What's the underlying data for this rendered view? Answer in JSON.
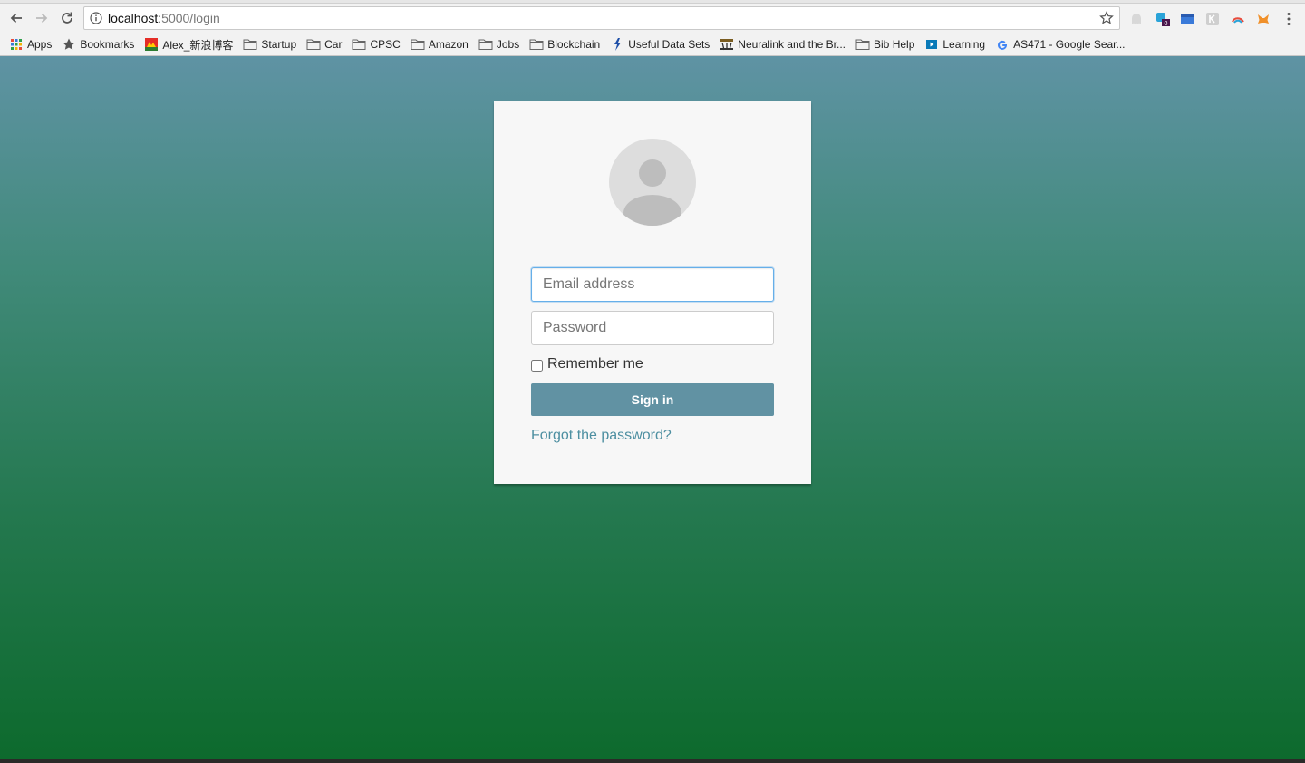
{
  "browser": {
    "url_host": "localhost",
    "url_path": ":5000/login",
    "bookmarks": [
      {
        "label": "Apps",
        "icon": "apps-grid-icon"
      },
      {
        "label": "Bookmarks",
        "icon": "star-icon"
      },
      {
        "label": "Alex_新浪博客",
        "icon": "weibo-icon"
      },
      {
        "label": "Startup",
        "icon": "folder-icon"
      },
      {
        "label": "Car",
        "icon": "folder-icon"
      },
      {
        "label": "CPSC",
        "icon": "folder-icon"
      },
      {
        "label": "Amazon",
        "icon": "folder-icon"
      },
      {
        "label": "Jobs",
        "icon": "folder-icon"
      },
      {
        "label": "Blockchain",
        "icon": "folder-icon"
      },
      {
        "label": "Useful Data Sets",
        "icon": "data-site-icon"
      },
      {
        "label": "Neuralink and the Br...",
        "icon": "waitbutwhy-icon"
      },
      {
        "label": "Bib Help",
        "icon": "folder-icon"
      },
      {
        "label": "Learning",
        "icon": "learning-icon"
      },
      {
        "label": "AS471 - Google Sear...",
        "icon": "google-icon"
      }
    ],
    "extension_badge": "0"
  },
  "login": {
    "email_placeholder": "Email address",
    "password_placeholder": "Password",
    "remember_label": "Remember me",
    "signin_label": "Sign in",
    "forgot_label": "Forgot the password?"
  }
}
